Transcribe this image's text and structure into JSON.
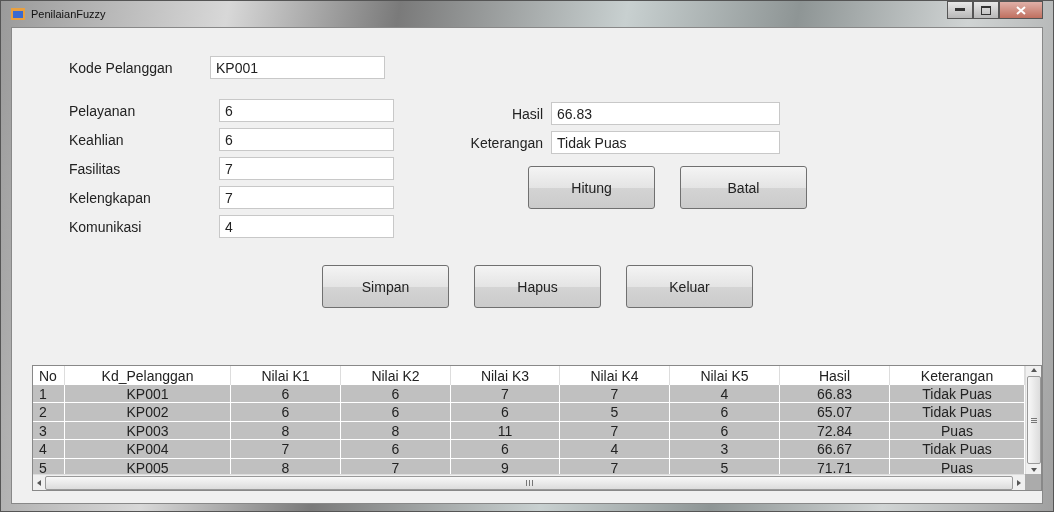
{
  "window": {
    "title": "PenilaianFuzzy"
  },
  "customer": {
    "label": "Kode Pelanggan",
    "value": "KP001"
  },
  "criteria": [
    {
      "label": "Pelayanan",
      "value": "6"
    },
    {
      "label": "Keahlian",
      "value": "6"
    },
    {
      "label": "Fasilitas",
      "value": "7"
    },
    {
      "label": "Kelengkapan",
      "value": "7"
    },
    {
      "label": "Komunikasi",
      "value": "4"
    }
  ],
  "results": [
    {
      "label": "Hasil",
      "value": "66.83"
    },
    {
      "label": "Keterangan",
      "value": "Tidak Puas"
    }
  ],
  "calc_buttons": [
    "Hitung",
    "Batal"
  ],
  "main_buttons": [
    "Simpan",
    "Hapus",
    "Keluar"
  ],
  "table": {
    "columns": [
      "No",
      "Kd_Pelanggan",
      "Nilai K1",
      "Nilai K2",
      "Nilai K3",
      "Nilai K4",
      "Nilai K5",
      "Hasil",
      "Keterangan"
    ],
    "rows": [
      [
        "1",
        "KP001",
        "6",
        "6",
        "7",
        "7",
        "4",
        "66.83",
        "Tidak Puas"
      ],
      [
        "2",
        "KP002",
        "6",
        "6",
        "6",
        "5",
        "6",
        "65.07",
        "Tidak Puas"
      ],
      [
        "3",
        "KP003",
        "8",
        "8",
        "11",
        "7",
        "6",
        "72.84",
        "Puas"
      ],
      [
        "4",
        "KP004",
        "7",
        "6",
        "6",
        "4",
        "3",
        "66.67",
        "Tidak Puas"
      ],
      [
        "5",
        "KP005",
        "8",
        "7",
        "9",
        "7",
        "5",
        "71.71",
        "Puas"
      ]
    ]
  }
}
